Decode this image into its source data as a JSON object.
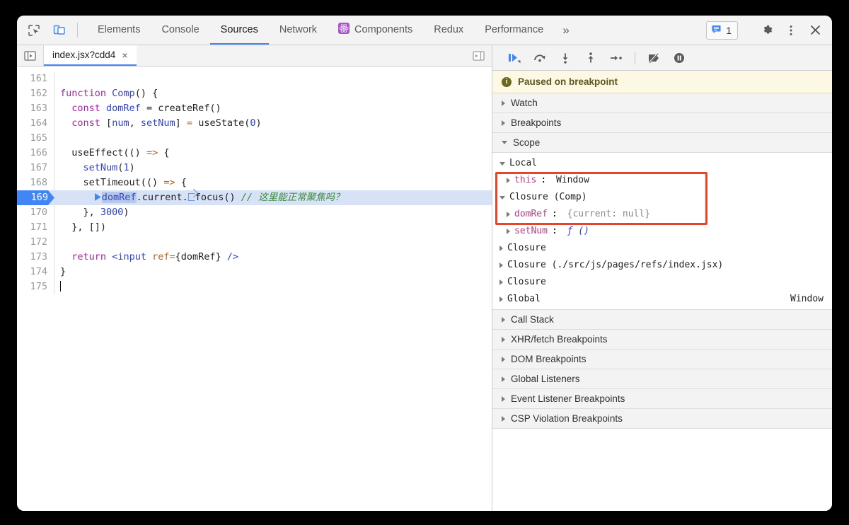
{
  "window": {
    "title": "Chrome DevTools"
  },
  "toolbar": {
    "inspect_icon": "inspect-element-icon",
    "device_icon": "device-toolbar-icon",
    "tabs": [
      {
        "label": "Elements",
        "active": false,
        "icon": null
      },
      {
        "label": "Console",
        "active": false,
        "icon": null
      },
      {
        "label": "Sources",
        "active": true,
        "icon": null
      },
      {
        "label": "Network",
        "active": false,
        "icon": null
      },
      {
        "label": "Components",
        "active": false,
        "icon": "react-components-icon"
      },
      {
        "label": "Redux",
        "active": false,
        "icon": null
      },
      {
        "label": "Performance",
        "active": false,
        "icon": null
      }
    ],
    "more_tabs_label": "»",
    "message_count": "1",
    "settings_icon": "gear-icon",
    "more_icon": "kebab-menu-icon",
    "close_icon": "close-icon",
    "react_icon_color": "#a855c8",
    "accent_color": "#4285f4"
  },
  "sources": {
    "navigator_toggle_icon": "show-navigator-icon",
    "right_panel_toggle_icon": "show-debugger-icon",
    "open_tab": {
      "name": "index.jsx?cdd4",
      "close_label": "×"
    }
  },
  "editor": {
    "current_line": "169",
    "lines": [
      {
        "num": "161",
        "blank": true
      },
      {
        "num": "162",
        "blank": false
      },
      {
        "num": "163",
        "blank": false
      },
      {
        "num": "164",
        "blank": false
      },
      {
        "num": "165",
        "blank": true
      },
      {
        "num": "166",
        "blank": false
      },
      {
        "num": "167",
        "blank": false
      },
      {
        "num": "168",
        "blank": false
      },
      {
        "num": "169",
        "blank": false
      },
      {
        "num": "170",
        "blank": false
      },
      {
        "num": "171",
        "blank": false
      },
      {
        "num": "172",
        "blank": true
      },
      {
        "num": "173",
        "blank": false
      },
      {
        "num": "174",
        "blank": false
      },
      {
        "num": "175",
        "blank": true
      }
    ],
    "code": {
      "l162": "function Comp() {",
      "l163": "const domRef = createRef()",
      "l164": "const [num, setNum] = useState(0)",
      "l166": "useEffect(() => {",
      "l167": "setNum(1)",
      "l168": "setTimeout(() => {",
      "l169": "domRef.current.focus() // 这里能正常聚焦吗？",
      "l170": "}, 3000)",
      "l171": "}, [])",
      "l173": "return <input ref={domRef} />",
      "l174": "}"
    },
    "tokens": {
      "kw_function": "function",
      "name_comp": "Comp",
      "paren_open_close": "() {",
      "kw_const": "const",
      "id_domref": "domRef",
      "eq": "=",
      "call_createref": "createRef()",
      "arr_open": "[",
      "id_num": "num",
      "comma": ", ",
      "id_setnum": "setNum",
      "arr_close": "]",
      "call_usestate": "useState(",
      "zero": "0",
      "close_paren": ")",
      "call_useeffect": "useEffect(()",
      "arrow": "=>",
      "brace_open": "{",
      "call_setnum": "setNum",
      "one": "1",
      "call_settimeout": "setTimeout(()",
      "domref_sel": "domRef",
      "dot_current_dot": ".current.",
      "focus_call": "focus()",
      "comment169": "// 这里能正常聚焦吗？",
      "close_3000": "}, ",
      "three_thousand": "3000",
      "close_paren2": ")",
      "close_deps": "}, [])",
      "kw_return": "return",
      "jsx_open": "<input",
      "jsx_attr": "ref=",
      "jsx_brace": "{domRef}",
      "jsx_close": "/>",
      "brace_close": "}"
    }
  },
  "debugger": {
    "controls": [
      {
        "name": "resume-script-execution",
        "icon": "resume-icon"
      },
      {
        "name": "step-over-next-function-call",
        "icon": "step-over-icon"
      },
      {
        "name": "step-into-next-function-call",
        "icon": "step-into-icon"
      },
      {
        "name": "step-out-of-current-function",
        "icon": "step-out-icon"
      },
      {
        "name": "step",
        "icon": "step-icon"
      },
      {
        "name": "deactivate-breakpoints",
        "icon": "deactivate-breakpoints-icon"
      },
      {
        "name": "pause-on-exceptions",
        "icon": "pause-on-exceptions-icon"
      }
    ],
    "paused_message": "Paused on breakpoint",
    "paused_icon": "info-icon",
    "paused_bg": "#fdf8e3",
    "sections": [
      {
        "label": "Watch",
        "expanded": false
      },
      {
        "label": "Breakpoints",
        "expanded": false
      },
      {
        "label": "Scope",
        "expanded": true
      }
    ],
    "scope": {
      "rows": [
        {
          "indent": 0,
          "expanded": true,
          "label": "Local",
          "type": "scope"
        },
        {
          "indent": 1,
          "expanded": false,
          "name": "this",
          "value": "Window",
          "type": "prop"
        },
        {
          "indent": 0,
          "expanded": true,
          "label": "Closure (Comp)",
          "type": "scope",
          "highlight": true
        },
        {
          "indent": 1,
          "expanded": false,
          "name": "domRef",
          "value": "{current: null}",
          "type": "prop",
          "highlight": true
        },
        {
          "indent": 1,
          "expanded": false,
          "name": "setNum",
          "value": "ƒ ()",
          "type": "prop-fn",
          "highlight": true
        },
        {
          "indent": 0,
          "expanded": false,
          "label": "Closure",
          "type": "scope"
        },
        {
          "indent": 0,
          "expanded": false,
          "label": "Closure (./src/js/pages/refs/index.jsx)",
          "type": "scope"
        },
        {
          "indent": 0,
          "expanded": false,
          "label": "Closure",
          "type": "scope"
        },
        {
          "indent": 0,
          "expanded": false,
          "label": "Global",
          "type": "scope",
          "right": "Window"
        }
      ],
      "highlight_color": "#e8442a"
    },
    "collapsed_sections": [
      "Call Stack",
      "XHR/fetch Breakpoints",
      "DOM Breakpoints",
      "Global Listeners",
      "Event Listener Breakpoints",
      "CSP Violation Breakpoints"
    ]
  }
}
